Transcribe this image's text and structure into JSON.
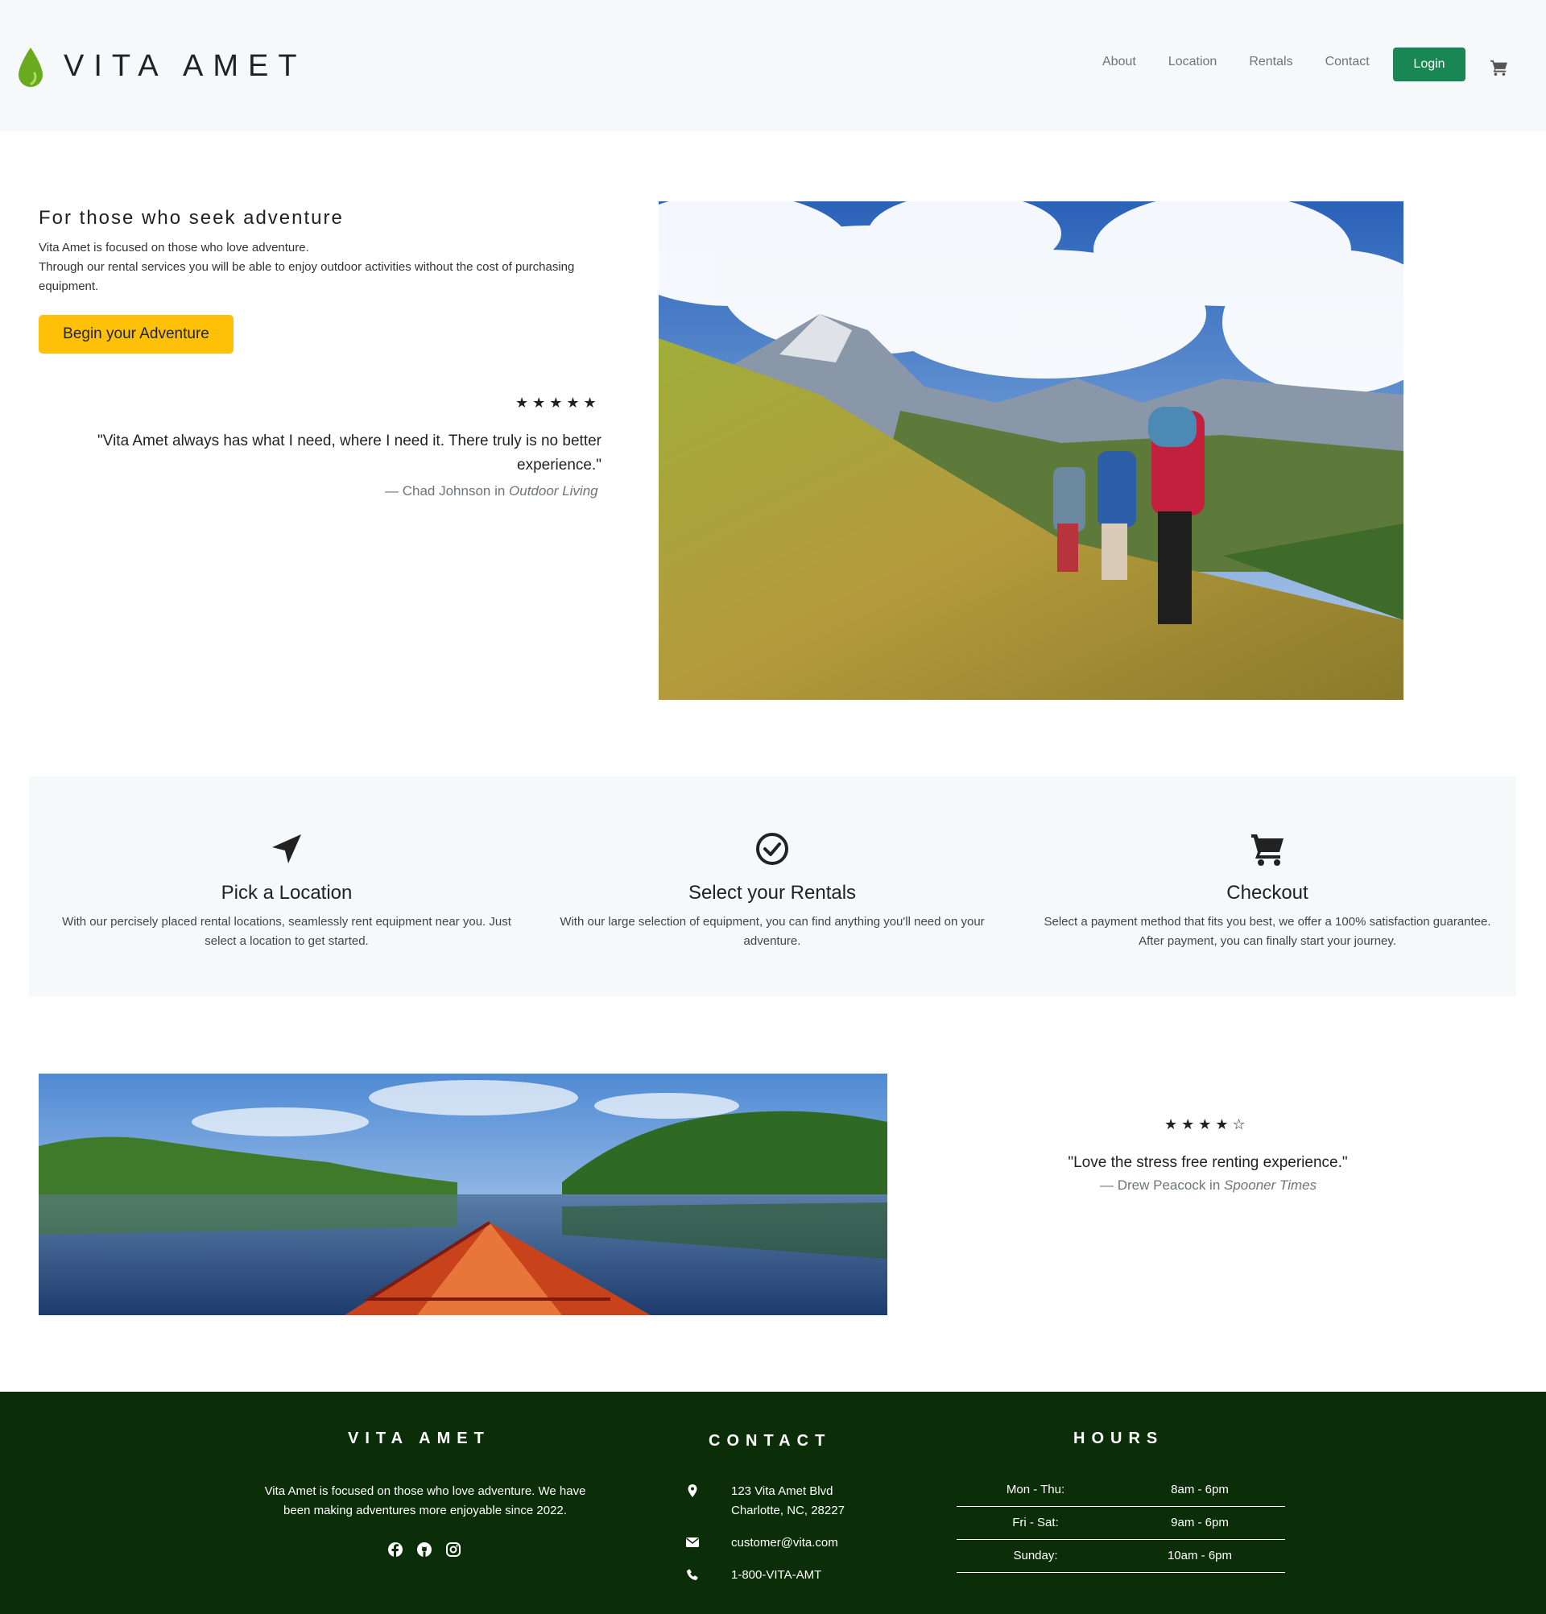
{
  "brand": {
    "name": "VITA AMET"
  },
  "nav": {
    "links": [
      "About",
      "Location",
      "Rentals",
      "Contact"
    ],
    "login": "Login",
    "cart_icon": "cart-icon"
  },
  "hero": {
    "title": "For those who seek adventure",
    "line1": "Vita Amet is focused on those who love adventure.",
    "line2": "Through our rental services you will be able to enjoy outdoor activities without the cost of purchasing equipment.",
    "button": "Begin your Adventure",
    "image_desc": "mountain-hikers-image"
  },
  "testimonial1": {
    "stars": "★★★★★",
    "quote": "\"Vita Amet always has what I need, where I need it. There truly is no better experience.\"",
    "author": "— Chad Johnson in ",
    "source": "Outdoor Living"
  },
  "steps": [
    {
      "icon": "location-arrow-icon",
      "title": "Pick a Location",
      "desc": "With our percisely placed rental locations, seamlessly rent equipment near you. Just select a location to get started."
    },
    {
      "icon": "check-circle-icon",
      "title": "Select your Rentals",
      "desc": "With our large selection of equipment, you can find anything you'll need on your adventure."
    },
    {
      "icon": "cart-icon",
      "title": "Checkout",
      "desc": "Select a payment method that fits you best, we offer a 100% satisfaction guarantee. After payment, you can finally start your journey."
    }
  ],
  "testimonial2": {
    "stars": "★★★★☆",
    "quote": "\"Love the stress free renting experience.\"",
    "author": "— Drew Peacock in ",
    "source": "Spooner Times"
  },
  "footer": {
    "brand": "VITA AMET",
    "about": "Vita Amet is focused on those who love adventure. We have been making adventures more enjoyable since 2022.",
    "contact_heading": "CONTACT",
    "address1": "123 Vita Amet Blvd",
    "address2": "Charlotte, NC, 28227",
    "email": "customer@vita.com",
    "phone": "1-800-VITA-AMT",
    "hours_heading": "HOURS",
    "hours": [
      {
        "day": "Mon - Thu:",
        "time": "8am - 6pm"
      },
      {
        "day": "Fri - Sat:",
        "time": "9am - 6pm"
      },
      {
        "day": "Sunday:",
        "time": "10am - 6pm"
      }
    ]
  },
  "colors": {
    "nav_bg": "#f7f8fa",
    "login_green": "#198754",
    "cta_yellow": "#ffc107",
    "footer_bg": "#0b2e09",
    "logo_green": "#6aaa1f"
  }
}
